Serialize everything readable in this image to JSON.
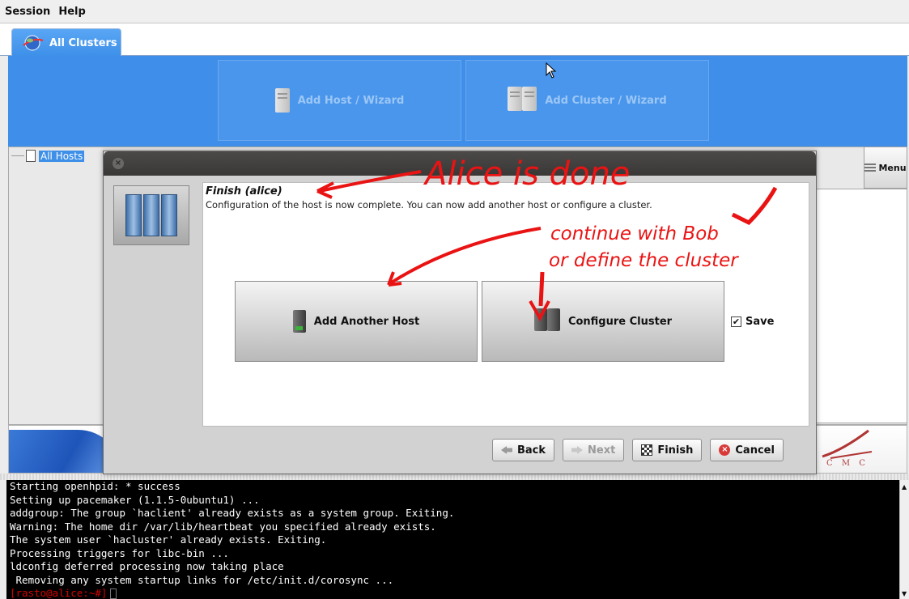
{
  "menubar": {
    "session": "Session",
    "help": "Help"
  },
  "tab": {
    "label": "All Clusters"
  },
  "toolbar": {
    "add_host": "Add Host / Wizard",
    "add_cluster": "Add Cluster / Wizard"
  },
  "tree": {
    "root": "All Hosts"
  },
  "menu_button": {
    "label": "Menu"
  },
  "banner": {
    "logo_text": "C M C"
  },
  "dialog": {
    "heading": "Finish (alice)",
    "description": "Configuration of the host is now complete. You can now add another host or configure a cluster.",
    "add_another_host": "Add Another Host",
    "configure_cluster": "Configure Cluster",
    "save_label": "Save",
    "save_checked": true,
    "back": "Back",
    "next": "Next",
    "finish": "Finish",
    "cancel": "Cancel"
  },
  "annotations": {
    "line1": "Alice is done",
    "line2": "continue with Bob",
    "line3": "or define the cluster"
  },
  "terminal": {
    "lines": [
      "Starting openhpid: * success",
      "Setting up pacemaker (1.1.5-0ubuntu1) ...",
      "addgroup: The group `haclient' already exists as a system group. Exiting.",
      "Warning: The home dir /var/lib/heartbeat you specified already exists.",
      "The system user `hacluster' already exists. Exiting.",
      "Processing triggers for libc-bin ...",
      "ldconfig deferred processing now taking place",
      " Removing any system startup links for /etc/init.d/corosync ..."
    ],
    "prompt": "[rasto@alice:~#]"
  },
  "colors": {
    "toolbar_blue": "#3f8fea",
    "annotation_red": "#ea1313",
    "prompt_red": "#d80000"
  }
}
